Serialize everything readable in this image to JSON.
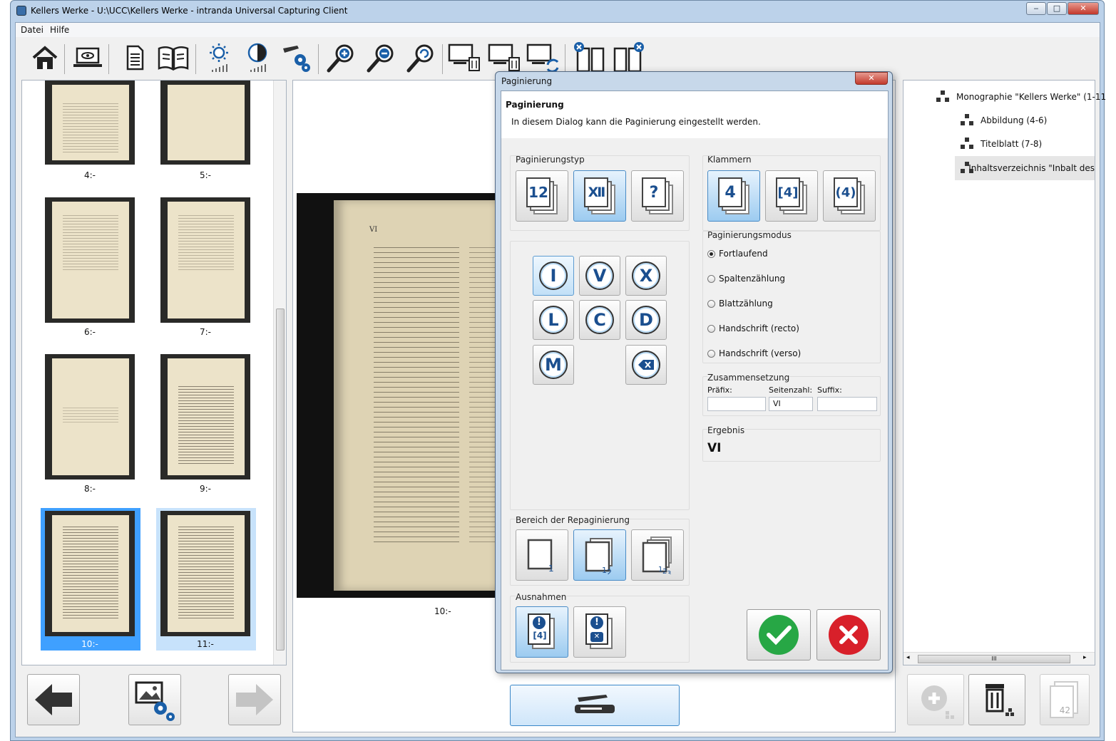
{
  "window": {
    "title": "Kellers Werke - U:\\UCC\\Kellers Werke - intranda Universal Capturing Client",
    "min": "‒",
    "max": "□",
    "close": "✕"
  },
  "menu": [
    "Datei",
    "Hilfe"
  ],
  "thumbnails": [
    {
      "label": "4:-"
    },
    {
      "label": "5:-"
    },
    {
      "label": "6:-"
    },
    {
      "label": "7:-"
    },
    {
      "label": "8:-"
    },
    {
      "label": "9:-"
    },
    {
      "label": "10:-"
    },
    {
      "label": "11:-"
    }
  ],
  "preview": {
    "caption": "10:-",
    "page_header_left": "VI"
  },
  "dialog": {
    "title": "Paginierung",
    "heading": "Paginierung",
    "description": "In diesem Dialog kann die Paginierung eingestellt werden.",
    "close": "✕",
    "paginierungstyp": {
      "label": "Paginierungstyp",
      "options": [
        "12",
        "XII",
        "?"
      ],
      "selected": "XII"
    },
    "klammern": {
      "label": "Klammern",
      "options": [
        "4",
        "[4]",
        "(4)"
      ],
      "selected": "4"
    },
    "roman_keys": [
      "I",
      "V",
      "X",
      "L",
      "C",
      "D",
      "M"
    ],
    "modus": {
      "label": "Paginierungsmodus",
      "options": [
        "Fortlaufend",
        "Spaltenzählung",
        "Blattzählung",
        "Handschrift (recto)",
        "Handschrift (verso)"
      ],
      "selected": "Fortlaufend"
    },
    "zusammensetzung": {
      "label": "Zusammensetzung",
      "prefix_label": "Präfix:",
      "page_label": "Seitenzahl:",
      "suffix_label": "Suffix:",
      "prefix": "",
      "page": "VI",
      "suffix": ""
    },
    "ergebnis": {
      "label": "Ergebnis",
      "value": "VI"
    },
    "bereich": {
      "label": "Bereich der Repaginierung",
      "selected": 1
    },
    "ausnahmen": {
      "label": "Ausnahmen",
      "icon_text": "[4]"
    }
  },
  "tree": [
    "Monographie \"Kellers Werke\" (1-11",
    "Abbildung (4-6)",
    "Titelblatt (7-8)",
    "Inhaltsverzeichnis \"Inbalt des"
  ],
  "right_panel": {
    "scroll_thumb": "III",
    "page_counter": "42"
  },
  "colors": {
    "accent": "#3fa0ff",
    "ok": "#27a745",
    "cancel": "#d8202a"
  }
}
